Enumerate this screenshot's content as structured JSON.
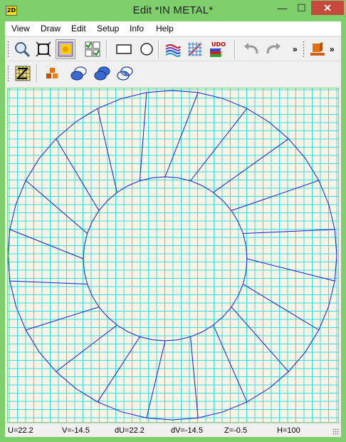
{
  "window": {
    "app_icon_text": "2D",
    "title": "Edit   *IN METAL*",
    "minimize_glyph": "—",
    "maximize_glyph": "☐",
    "close_glyph": "✕"
  },
  "menu": [
    "View",
    "Draw",
    "Edit",
    "Setup",
    "Info",
    "Help"
  ],
  "toolbar1": {
    "tools": [
      {
        "icon": "zoom-icon"
      },
      {
        "icon": "zoom-extents-icon"
      },
      {
        "icon": "highlight-select-icon",
        "pressed": true
      },
      {
        "icon": "checklist-icon"
      },
      {
        "icon": "rectangle-icon"
      },
      {
        "icon": "circle-icon"
      },
      {
        "icon": "layers-icon"
      },
      {
        "icon": "grid-icon"
      },
      {
        "icon": "udo-icon",
        "label": "UDO"
      },
      {
        "icon": "undo-icon"
      },
      {
        "icon": "redo-icon"
      },
      {
        "icon": "material-block-icon"
      }
    ],
    "overflow_glyph": "»"
  },
  "toolbar2": {
    "tools": [
      {
        "icon": "grid-z-icon"
      },
      {
        "icon": "blocks-icon"
      },
      {
        "icon": "ellipse-add-icon"
      },
      {
        "icon": "ellipse-union-icon"
      },
      {
        "icon": "ellipse-intersect-icon"
      }
    ]
  },
  "colors": {
    "frame": "#7fce6c",
    "canvas_bg": "#fbf4e6",
    "grid_line": "#2fe0e0",
    "mesh_line": "#0b1fd6",
    "close_button": "#c7483c"
  },
  "status": {
    "u": "U=22.2",
    "v": "V=-14.5",
    "du": "dU=22.2",
    "dv": "dV=-14.5",
    "z": "Z=-0.5",
    "h": "H=100"
  }
}
